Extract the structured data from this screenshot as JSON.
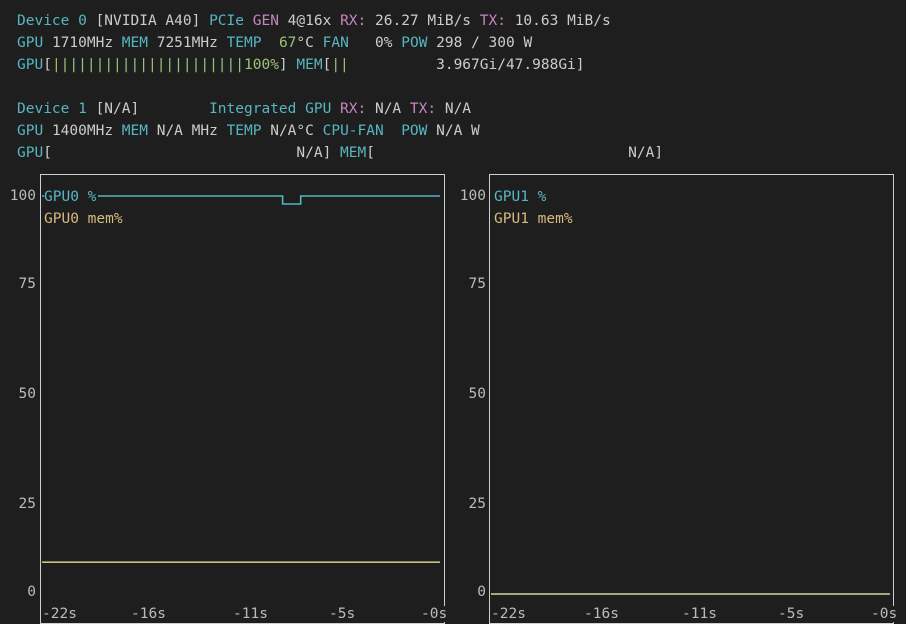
{
  "device0": {
    "line1": {
      "device_label": "Device 0",
      "name": "[NVIDIA A40]",
      "pcie_label": "PCIe",
      "gen_label": "GEN",
      "gen_value": "4@16x",
      "rx_label": "RX:",
      "rx_value": "26.27 MiB/s",
      "tx_label": "TX:",
      "tx_value": "10.63 MiB/s"
    },
    "line2": {
      "gpu_label": "GPU",
      "gpu_clock": "1710MHz",
      "mem_label": "MEM",
      "mem_clock": "7251MHz",
      "temp_label": "TEMP",
      "temp_value": "67",
      "temp_unit": "°C",
      "fan_label": "FAN",
      "fan_value": "0%",
      "pow_label": "POW",
      "pow_value": "298 / 300 W"
    },
    "line3": {
      "gpu_label": "GPU",
      "gpu_bar": "||||||||||||||||||||||",
      "gpu_pct": "100%",
      "mem_label": "MEM",
      "mem_bar": "||",
      "mem_value": "3.967Gi/47.988Gi"
    }
  },
  "device1": {
    "line1": {
      "device_label": "Device 1",
      "name": "[N/A]",
      "integrated": "Integrated GPU",
      "rx_label": "RX:",
      "rx_value": "N/A",
      "tx_label": "TX:",
      "tx_value": "N/A"
    },
    "line2": {
      "gpu_label": "GPU",
      "gpu_clock": "1400MHz",
      "mem_label": "MEM",
      "mem_clock": "N/A MHz",
      "temp_label": "TEMP",
      "temp_value": "N/A°C",
      "fan_label": "CPU-FAN",
      "pow_label": "POW",
      "pow_value": "N/A W"
    },
    "line3": {
      "gpu_label": "GPU",
      "gpu_value": "N/A",
      "mem_label": "MEM",
      "mem_value": "N/A"
    }
  },
  "colors": {
    "gpu_series": "#56b6c2",
    "mem_series": "#c9bf7e",
    "border": "#cfcfcf"
  },
  "chart_data": [
    {
      "type": "line",
      "title": "",
      "x_ticks": [
        "-22s",
        "-16s",
        "-11s",
        "-5s",
        "-0s"
      ],
      "y_ticks": [
        "100",
        "75",
        "50",
        "25",
        "0"
      ],
      "ylim": [
        0,
        100
      ],
      "xlim": [
        -22,
        0
      ],
      "series": [
        {
          "name": "GPU0 %",
          "color": "#56b6c2",
          "x": [
            -22,
            -8.7,
            -8.7,
            -7.7,
            -7.7,
            0
          ],
          "y": [
            100,
            100,
            98,
            98,
            100,
            100
          ]
        },
        {
          "name": "GPU0 mem%",
          "color": "#c9bf7e",
          "x": [
            -22,
            0
          ],
          "y": [
            8,
            8
          ]
        }
      ]
    },
    {
      "type": "line",
      "title": "",
      "x_ticks": [
        "-22s",
        "-16s",
        "-11s",
        "-5s",
        "-0s"
      ],
      "y_ticks": [
        "100",
        "75",
        "50",
        "25",
        "0"
      ],
      "ylim": [
        0,
        100
      ],
      "xlim": [
        -22,
        0
      ],
      "series": [
        {
          "name": "GPU1 %",
          "color": "#56b6c2",
          "x": [
            -22,
            0
          ],
          "y": [
            0,
            0
          ]
        },
        {
          "name": "GPU1 mem%",
          "color": "#c9bf7e",
          "x": [
            -22,
            0
          ],
          "y": [
            0,
            0
          ]
        }
      ]
    }
  ]
}
